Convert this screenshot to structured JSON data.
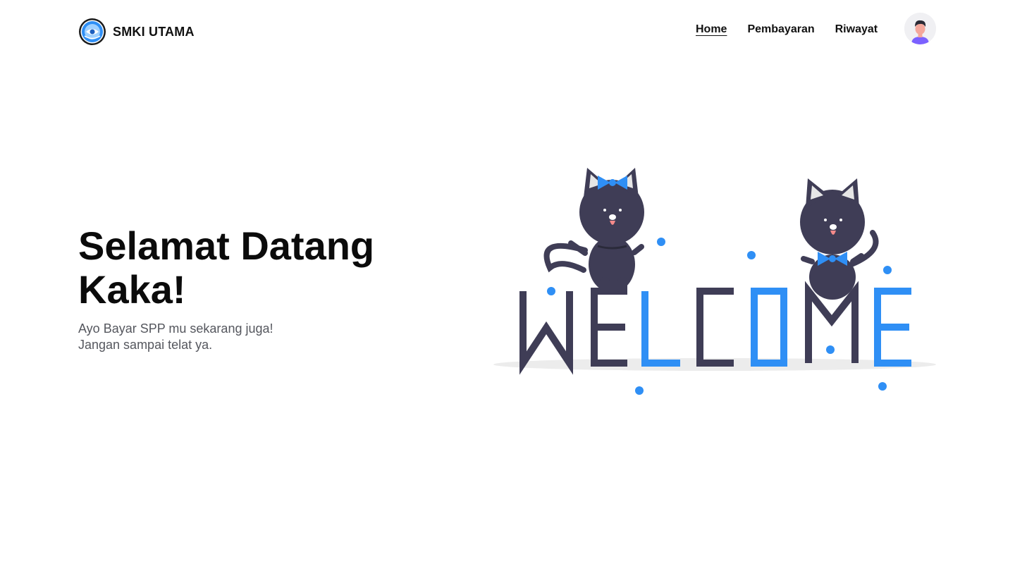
{
  "brand": {
    "name": "SMKI UTAMA",
    "logo_icon": "school-emblem-icon"
  },
  "nav": {
    "items": [
      {
        "label": "Home",
        "active": true
      },
      {
        "label": "Pembayaran",
        "active": false
      },
      {
        "label": "Riwayat",
        "active": false
      }
    ],
    "avatar_icon": "user-avatar-icon"
  },
  "hero": {
    "title": "Selamat Datang Kaka!",
    "subtitle_line1": "Ayo Bayar SPP mu sekarang juga!",
    "subtitle_line2": "Jangan sampai telat ya.",
    "illustration": {
      "word": "WELCOME",
      "icon": "welcome-cats-illustration"
    }
  },
  "colors": {
    "accent": "#2f8ff5",
    "dark": "#3f3d56",
    "text": "#111111",
    "muted": "#55575e"
  }
}
